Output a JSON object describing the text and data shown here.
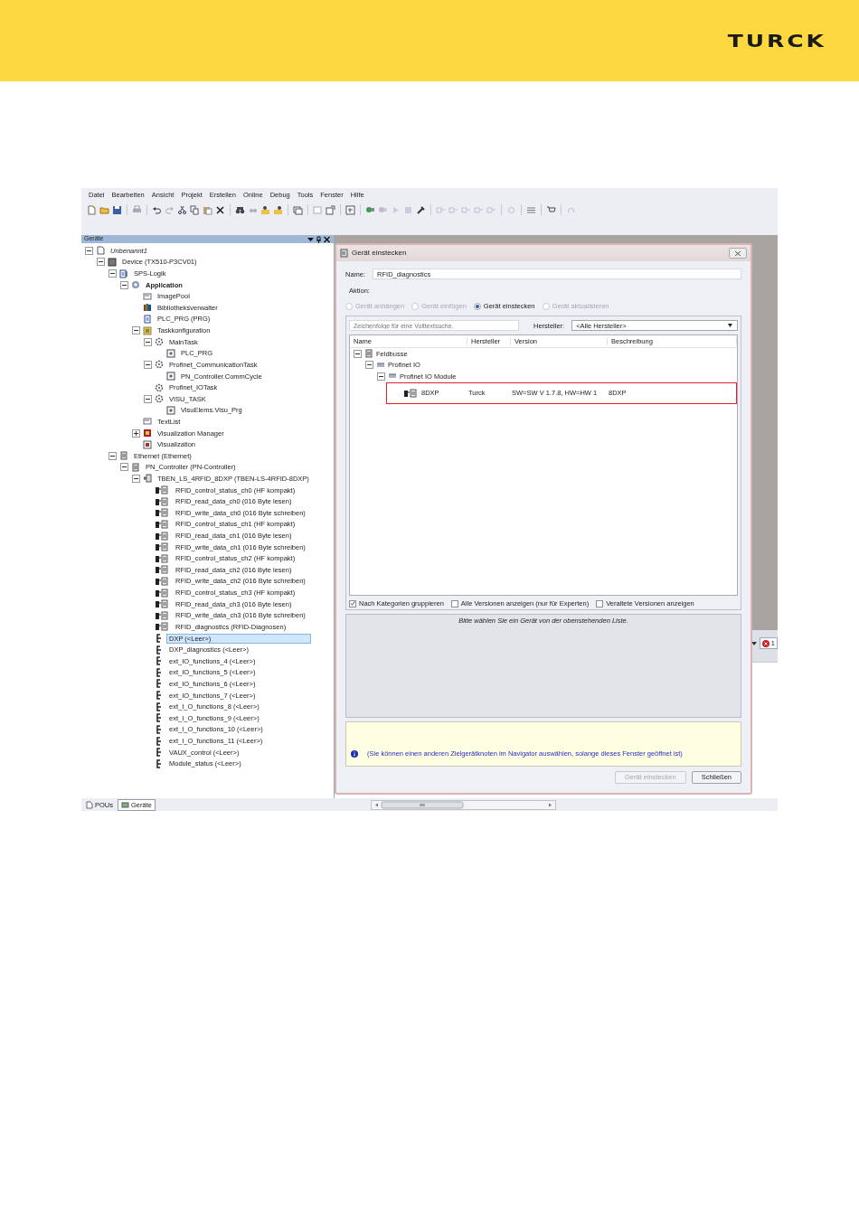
{
  "header": {
    "logo": "TURCK"
  },
  "menu": [
    "Datei",
    "Bearbeiten",
    "Ansicht",
    "Projekt",
    "Erstellen",
    "Online",
    "Debug",
    "Tools",
    "Fenster",
    "Hilfe"
  ],
  "panel": {
    "title": "Geräte",
    "tree": [
      {
        "label": "Unbenannt1",
        "kind": "project",
        "selected": false,
        "expanded": true,
        "children": [
          {
            "label": "Device (TX510-P3CV01)",
            "kind": "device",
            "selected": false,
            "expanded": true,
            "children": [
              {
                "label": "SPS-Logik",
                "kind": "plc",
                "selected": false,
                "expanded": true,
                "children": [
                  {
                    "label": "Application",
                    "kind": "app",
                    "selected": false,
                    "expanded": true,
                    "children": [
                      {
                        "label": "ImagePool",
                        "kind": "pool",
                        "selected": false
                      },
                      {
                        "label": "Bibliotheksverwalter",
                        "kind": "library",
                        "selected": false
                      },
                      {
                        "label": "PLC_PRG (PRG)",
                        "kind": "prg",
                        "selected": false
                      },
                      {
                        "label": "Taskkonfiguration",
                        "kind": "taskconfig",
                        "selected": false,
                        "expanded": true,
                        "children": [
                          {
                            "label": "MainTask",
                            "kind": "task",
                            "selected": false,
                            "expanded": true,
                            "children": [
                              {
                                "label": "PLC_PRG",
                                "kind": "call",
                                "selected": false
                              }
                            ]
                          },
                          {
                            "label": "Profinet_CommunicationTask",
                            "kind": "task",
                            "selected": false,
                            "expanded": true,
                            "children": [
                              {
                                "label": "PN_Controller.CommCycle",
                                "kind": "call",
                                "selected": false
                              }
                            ]
                          },
                          {
                            "label": "Profinet_IOTask",
                            "kind": "task",
                            "selected": false
                          },
                          {
                            "label": "VISU_TASK",
                            "kind": "task",
                            "selected": false,
                            "expanded": true,
                            "children": [
                              {
                                "label": "VisuElems.Visu_Prg",
                                "kind": "call",
                                "selected": false
                              }
                            ]
                          }
                        ]
                      },
                      {
                        "label": "TextList",
                        "kind": "pool",
                        "selected": false
                      },
                      {
                        "label": "Visualization Manager",
                        "kind": "visumgr",
                        "selected": false,
                        "expanded": false
                      },
                      {
                        "label": "Visualization",
                        "kind": "visu",
                        "selected": false
                      }
                    ]
                  }
                ]
              },
              {
                "label": "Ethernet (Ethernet)",
                "kind": "bus",
                "selected": false,
                "expanded": true,
                "children": [
                  {
                    "label": "PN_Controller (PN-Controller)",
                    "kind": "bus",
                    "selected": false,
                    "expanded": true,
                    "children": [
                      {
                        "label": "TBEN_LS_4RFID_8DXP (TBEN-LS-4RFID-8DXP)",
                        "kind": "station",
                        "selected": false,
                        "expanded": true,
                        "children": [
                          {
                            "label": "RFID_control_status_ch0 (HF kompakt)",
                            "kind": "module",
                            "selected": false
                          },
                          {
                            "label": "RFID_read_data_ch0 (016 Byte lesen)",
                            "kind": "module",
                            "selected": false
                          },
                          {
                            "label": "RFID_write_data_ch0 (016 Byte schreiben)",
                            "kind": "module",
                            "selected": false
                          },
                          {
                            "label": "RFID_control_status_ch1 (HF kompakt)",
                            "kind": "module",
                            "selected": false
                          },
                          {
                            "label": "RFID_read_data_ch1 (016 Byte lesen)",
                            "kind": "module",
                            "selected": false
                          },
                          {
                            "label": "RFID_write_data_ch1 (016 Byte schreiben)",
                            "kind": "module",
                            "selected": false
                          },
                          {
                            "label": "RFID_control_status_ch2 (HF kompakt)",
                            "kind": "module",
                            "selected": false
                          },
                          {
                            "label": "RFID_read_data_ch2 (016 Byte lesen)",
                            "kind": "module",
                            "selected": false
                          },
                          {
                            "label": "RFID_write_data_ch2 (016 Byte schreiben)",
                            "kind": "module",
                            "selected": false
                          },
                          {
                            "label": "RFID_control_status_ch3 (HF kompakt)",
                            "kind": "module",
                            "selected": false
                          },
                          {
                            "label": "RFID_read_data_ch3 (016 Byte lesen)",
                            "kind": "module",
                            "selected": false
                          },
                          {
                            "label": "RFID_write_data_ch3 (016 Byte schreiben)",
                            "kind": "module",
                            "selected": false
                          },
                          {
                            "label": "RFID_diagnostics (RFID-Diagnosen)",
                            "kind": "module",
                            "selected": false
                          },
                          {
                            "label": "DXP (<Leer>)",
                            "kind": "slot",
                            "selected": true
                          },
                          {
                            "label": "DXP_diagnostics (<Leer>)",
                            "kind": "slot",
                            "selected": false
                          },
                          {
                            "label": "ext_IO_functions_4 (<Leer>)",
                            "kind": "slot",
                            "selected": false
                          },
                          {
                            "label": "ext_IO_functions_5 (<Leer>)",
                            "kind": "slot",
                            "selected": false
                          },
                          {
                            "label": "ext_IO_functions_6 (<Leer>)",
                            "kind": "slot",
                            "selected": false
                          },
                          {
                            "label": "ext_IO_functions_7 (<Leer>)",
                            "kind": "slot",
                            "selected": false
                          },
                          {
                            "label": "ext_I_O_functions_8 (<Leer>)",
                            "kind": "slot",
                            "selected": false
                          },
                          {
                            "label": "ext_I_O_functions_9 (<Leer>)",
                            "kind": "slot",
                            "selected": false
                          },
                          {
                            "label": "ext_I_O_functions_10 (<Leer>)",
                            "kind": "slot",
                            "selected": false
                          },
                          {
                            "label": "ext_I_O_functions_11 (<Leer>)",
                            "kind": "slot",
                            "selected": false
                          },
                          {
                            "label": "VAUX_control (<Leer>)",
                            "kind": "slot",
                            "selected": false
                          },
                          {
                            "label": "Module_status (<Leer>)",
                            "kind": "slot",
                            "selected": false
                          }
                        ]
                      }
                    ]
                  }
                ]
              }
            ]
          }
        ]
      }
    ]
  },
  "bottom_tabs": [
    {
      "label": "POUs",
      "selected": false
    },
    {
      "label": "Geräte",
      "selected": true
    }
  ],
  "error_indicator": {
    "count": "1"
  },
  "dialog": {
    "title": "Gerät einstecken",
    "name_label": "Name:",
    "name_value": "RFID_diagnostics",
    "action_label": "Aktion:",
    "actions": [
      {
        "label": "Gerät anhängen",
        "selected": false,
        "disabled": true
      },
      {
        "label": "Gerät einfügen",
        "selected": false,
        "disabled": true
      },
      {
        "label": "Gerät einstecken",
        "selected": true,
        "disabled": false
      },
      {
        "label": "Gerät aktualisieren",
        "selected": false,
        "disabled": true
      }
    ],
    "search": {
      "placeholder": "Zeichenfolge für eine Volltextsuche."
    },
    "vendor_label": "Hersteller:",
    "vendor_value": "<Alle Hersteller>",
    "columns": [
      "Name",
      "Hersteller",
      "Version",
      "Beschreibung"
    ],
    "rows": [
      {
        "name": "Feldbusse",
        "kind": "bus",
        "selected": false,
        "expanded": true,
        "children": [
          {
            "name": "Profinet IO",
            "kind": "profinet",
            "selected": false,
            "expanded": true,
            "children": [
              {
                "name": "Profinet IO Module",
                "kind": "profinet",
                "selected": false,
                "expanded": true,
                "children": [
                  {
                    "name": "8DXP",
                    "kind": "module",
                    "vendor": "Turck",
                    "version": "SW=SW V 1.7.8, HW=HW 1",
                    "description": "8DXP",
                    "selected": false,
                    "highlighted": true
                  }
                ]
              }
            ]
          }
        ]
      }
    ],
    "options": [
      {
        "label": "Nach Kategorien gruppieren",
        "checked": true
      },
      {
        "label": "Alle Versionen anzeigen (nur für Experten)",
        "checked": false
      },
      {
        "label": "Veraltete Versionen anzeigen",
        "checked": false
      }
    ],
    "info_text": "Bitte wählen Sie ein Gerät von der obenstehenden Liste.",
    "hint": "(Sie können einen anderen Zielgerätknoten im Navigator auswählen, solange dieses Fenster geöffnet ist)",
    "buttons": [
      {
        "label": "Gerät einstecken",
        "disabled": true
      },
      {
        "label": "Schließen",
        "disabled": false
      }
    ]
  }
}
